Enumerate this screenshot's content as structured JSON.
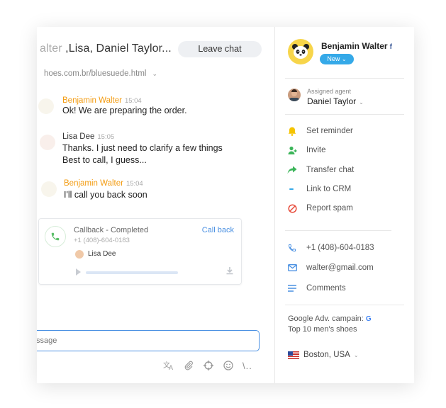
{
  "chat": {
    "title_faded": "alter",
    "title": " ,Lisa, Daniel Taylor...",
    "leave_label": "Leave chat",
    "url": "hoes.com.br/bluesuede.html",
    "messages": [
      {
        "name": "Benjamin Walter",
        "time": "15:04",
        "lines": [
          "Ok! We are preparing the order."
        ],
        "name_color": "#f39c12"
      },
      {
        "name": "Lisa Dee",
        "time": "15:05",
        "lines": [
          "Thanks. I just need to clarify a few things",
          "Best to call, I guess..."
        ],
        "name_color": "#333333"
      },
      {
        "name": "Benjamin Walter",
        "time": "15:04",
        "lines": [
          "I'll call you back soon"
        ],
        "name_color": "#f39c12"
      }
    ],
    "callback": {
      "title": "Callback - Completed",
      "phone": "+1 (408)-604-0183",
      "action": "Call back",
      "agent": "Lisa Dee"
    },
    "input_placeholder": "ssage",
    "tools": [
      "translate-icon",
      "attach-icon",
      "crosshair-icon",
      "emoji-icon",
      "more-icon"
    ],
    "more_label": "\\.."
  },
  "sidebar": {
    "customer_name": "Benjamin Walter",
    "facebook_glyph": "f",
    "status": "New",
    "assigned_label": "Assigned agent",
    "assigned_agent": "Daniel Taylor",
    "actions": [
      {
        "label": "Set reminder",
        "icon": "bell-icon",
        "color": "#f5c400"
      },
      {
        "label": "Invite",
        "icon": "invite-user-icon",
        "color": "#3cb55a"
      },
      {
        "label": "Transfer chat",
        "icon": "transfer-arrow-icon",
        "color": "#3cb55a"
      },
      {
        "label": "Link to CRM",
        "icon": "link-icon",
        "color": "#35a9e8"
      },
      {
        "label": "Report spam",
        "icon": "ban-icon",
        "color": "#e74c3c"
      }
    ],
    "contacts": {
      "phone": "+1 (408)-604-0183",
      "email": "walter@gmail.com",
      "comments": "Comments"
    },
    "campaign_label": "Google Adv. campain:",
    "google_glyph": "G",
    "campaign_value": "Top 10 men's shoes",
    "location": "Boston, USA"
  },
  "colors": {
    "accent": "#4a90e2",
    "status": "#35a9e8",
    "agent_name": "#f39c12"
  }
}
